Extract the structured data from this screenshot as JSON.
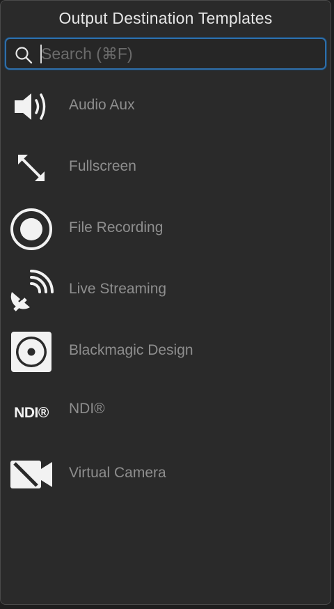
{
  "header": {
    "title": "Output Destination Templates"
  },
  "search": {
    "placeholder": "Search (⌘F)",
    "value": ""
  },
  "items": [
    {
      "label": "Audio Aux",
      "icon": "speaker-icon"
    },
    {
      "label": "Fullscreen",
      "icon": "fullscreen-arrows-icon"
    },
    {
      "label": "File Recording",
      "icon": "record-icon"
    },
    {
      "label": "Live Streaming",
      "icon": "satellite-dish-icon"
    },
    {
      "label": "Blackmagic Design",
      "icon": "blackmagic-icon"
    },
    {
      "label": "NDI®",
      "icon": "ndi-icon",
      "icon_text": "NDI®"
    },
    {
      "label": "Virtual Camera",
      "icon": "virtual-camera-icon"
    }
  ],
  "colors": {
    "accent": "#2f6ea8",
    "icon": "#f2f2f2",
    "label": "#8e8e8e"
  }
}
